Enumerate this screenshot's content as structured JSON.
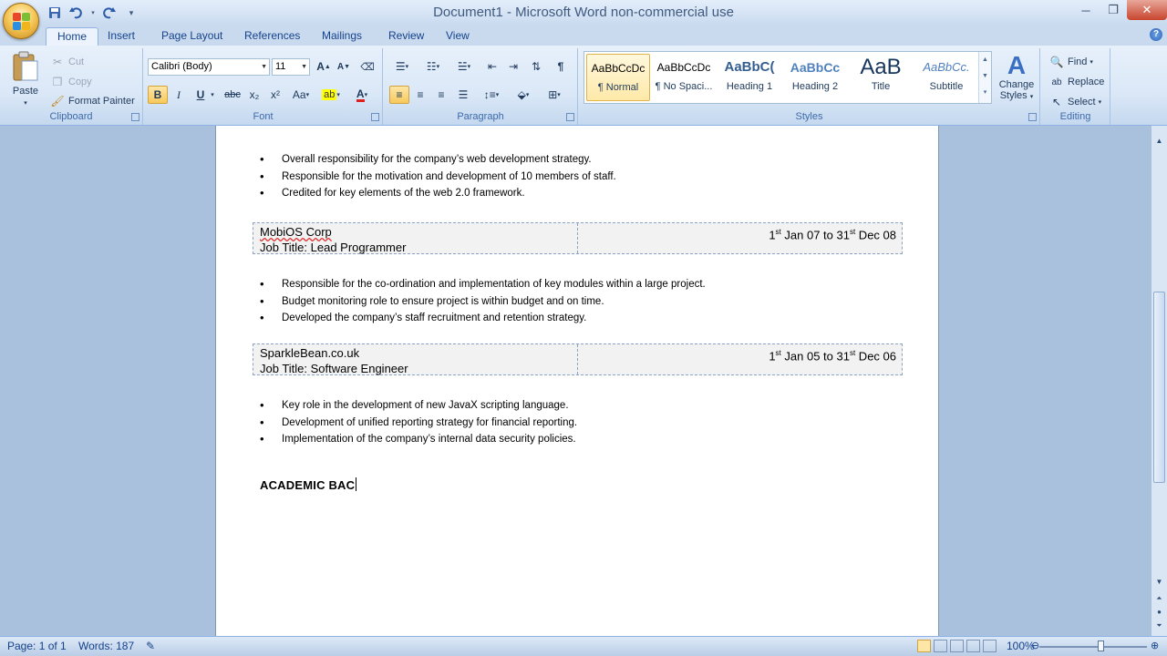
{
  "window": {
    "title": "Document1 - Microsoft Word non-commercial use",
    "minimize": "─",
    "maximize": "❐",
    "close": "✕"
  },
  "qat": {
    "save": "save-icon",
    "undo": "undo-icon",
    "redo": "redo-icon",
    "customize": "▾"
  },
  "tabs": [
    "Home",
    "Insert",
    "Page Layout",
    "References",
    "Mailings",
    "Review",
    "View"
  ],
  "help": "?",
  "ribbon": {
    "clipboard": {
      "label": "Clipboard",
      "paste": "Paste",
      "cut": "Cut",
      "copy": "Copy",
      "format_painter": "Format Painter"
    },
    "font": {
      "label": "Font",
      "font_name": "Calibri (Body)",
      "font_size": "11",
      "bold": "B",
      "italic": "I",
      "underline": "U",
      "strike": "abc",
      "sub": "x₂",
      "sup": "x²",
      "change_case": "Aa",
      "grow": "A",
      "shrink": "A",
      "font_color_letter": "A"
    },
    "paragraph": {
      "label": "Paragraph",
      "pilcrow": "¶"
    },
    "styles": {
      "label": "Styles",
      "items": [
        {
          "sample": "AaBbCcDc",
          "name": "¶ Normal"
        },
        {
          "sample": "AaBbCcDc",
          "name": "¶ No Spaci..."
        },
        {
          "sample": "AaBbC(",
          "name": "Heading 1"
        },
        {
          "sample": "AaBbCc",
          "name": "Heading 2"
        },
        {
          "sample": "AaB",
          "name": "Title"
        },
        {
          "sample": "AaBbCc.",
          "name": "Subtitle"
        }
      ],
      "change_styles_line1": "Change",
      "change_styles_line2": "Styles"
    },
    "editing": {
      "label": "Editing",
      "find": "Find",
      "replace": "Replace",
      "select": "Select"
    }
  },
  "document": {
    "bullets_1": [
      "Overall responsibility for the company’s web development strategy.",
      "Responsible for the motivation  and  development of 10 members of staff.",
      "Credited for key elements of the web 2.0 framework."
    ],
    "job_1": {
      "company": "MobiOS Corp",
      "title": "Job Title: Lead Programmer",
      "date_start_day": "1",
      "date_start_rest": " Jan 07   to  31",
      "date_end_rest": " Dec 08",
      "sup": "st"
    },
    "bullets_2": [
      "Responsible for the co-ordination and implementation  of key modules within a large project.",
      "Budget monitoring role to ensure project is within budget and on time.",
      "Developed the company’s staff recruitment and retention strategy."
    ],
    "job_2": {
      "company": "SparkleBean.co.uk",
      "title": "Job Title: Software Engineer",
      "date_start_day": "1",
      "date_start_rest": " Jan 05   to  31",
      "date_end_rest": " Dec 06",
      "sup": "st"
    },
    "bullets_3": [
      "Key role in the development of new JavaX scripting language.",
      "Development of unified reporting strategy for financial reporting.",
      "Implementation of the company’s internal data  security policies."
    ],
    "heading": "ACADEMIC BAC"
  },
  "status": {
    "page": "Page: 1 of 1",
    "words": "Words: 187",
    "zoom": "100%",
    "zoom_level_percent": 100
  }
}
